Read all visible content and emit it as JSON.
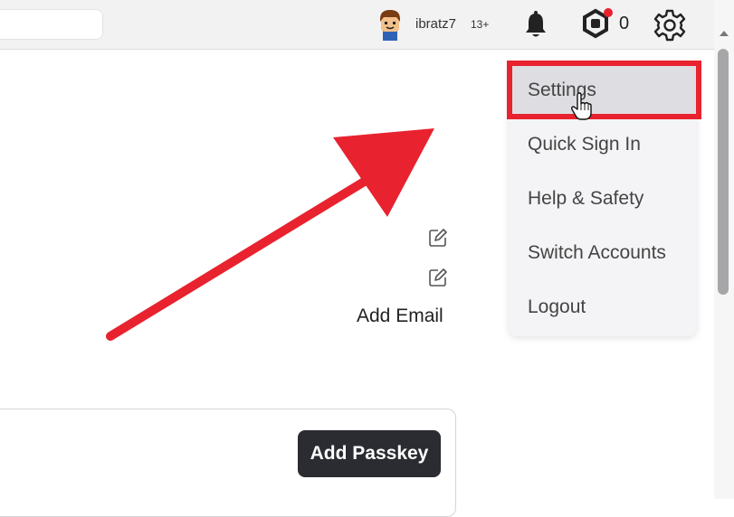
{
  "header": {
    "username": "ibratz7",
    "age_badge": "13+",
    "robux_count": "0",
    "icons": [
      "bell-icon",
      "robux-icon",
      "gear-icon"
    ],
    "notification_dot_color": "#e8222e"
  },
  "main": {
    "add_email_label": "Add Email",
    "add_passkey_label": "Add Passkey"
  },
  "settings_menu": {
    "items": [
      {
        "label": "Settings"
      },
      {
        "label": "Quick Sign In"
      },
      {
        "label": "Help & Safety"
      },
      {
        "label": "Switch Accounts"
      },
      {
        "label": "Logout"
      }
    ],
    "active_item": "Settings"
  },
  "annotation": {
    "color": "#e8222e"
  }
}
